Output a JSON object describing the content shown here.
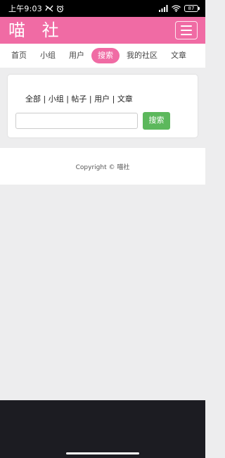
{
  "status_bar": {
    "time": "上午9:03",
    "battery": "87"
  },
  "app": {
    "title": "喵 社",
    "accent_color": "#f06ba4",
    "menu_icon": "hamburger-menu-icon"
  },
  "tabs": [
    {
      "label": "首页",
      "active": false
    },
    {
      "label": "小组",
      "active": false
    },
    {
      "label": "用户",
      "active": false
    },
    {
      "label": "搜索",
      "active": true
    },
    {
      "label": "我的社区",
      "active": false
    },
    {
      "label": "文章",
      "active": false
    }
  ],
  "search": {
    "filters": [
      "全部",
      "小组",
      "帖子",
      "用户",
      "文章"
    ],
    "separator": " | ",
    "input_value": "",
    "button_label": "搜索",
    "button_color": "#5cb85c"
  },
  "footer": {
    "copyright": "Copyright © 喵社"
  }
}
